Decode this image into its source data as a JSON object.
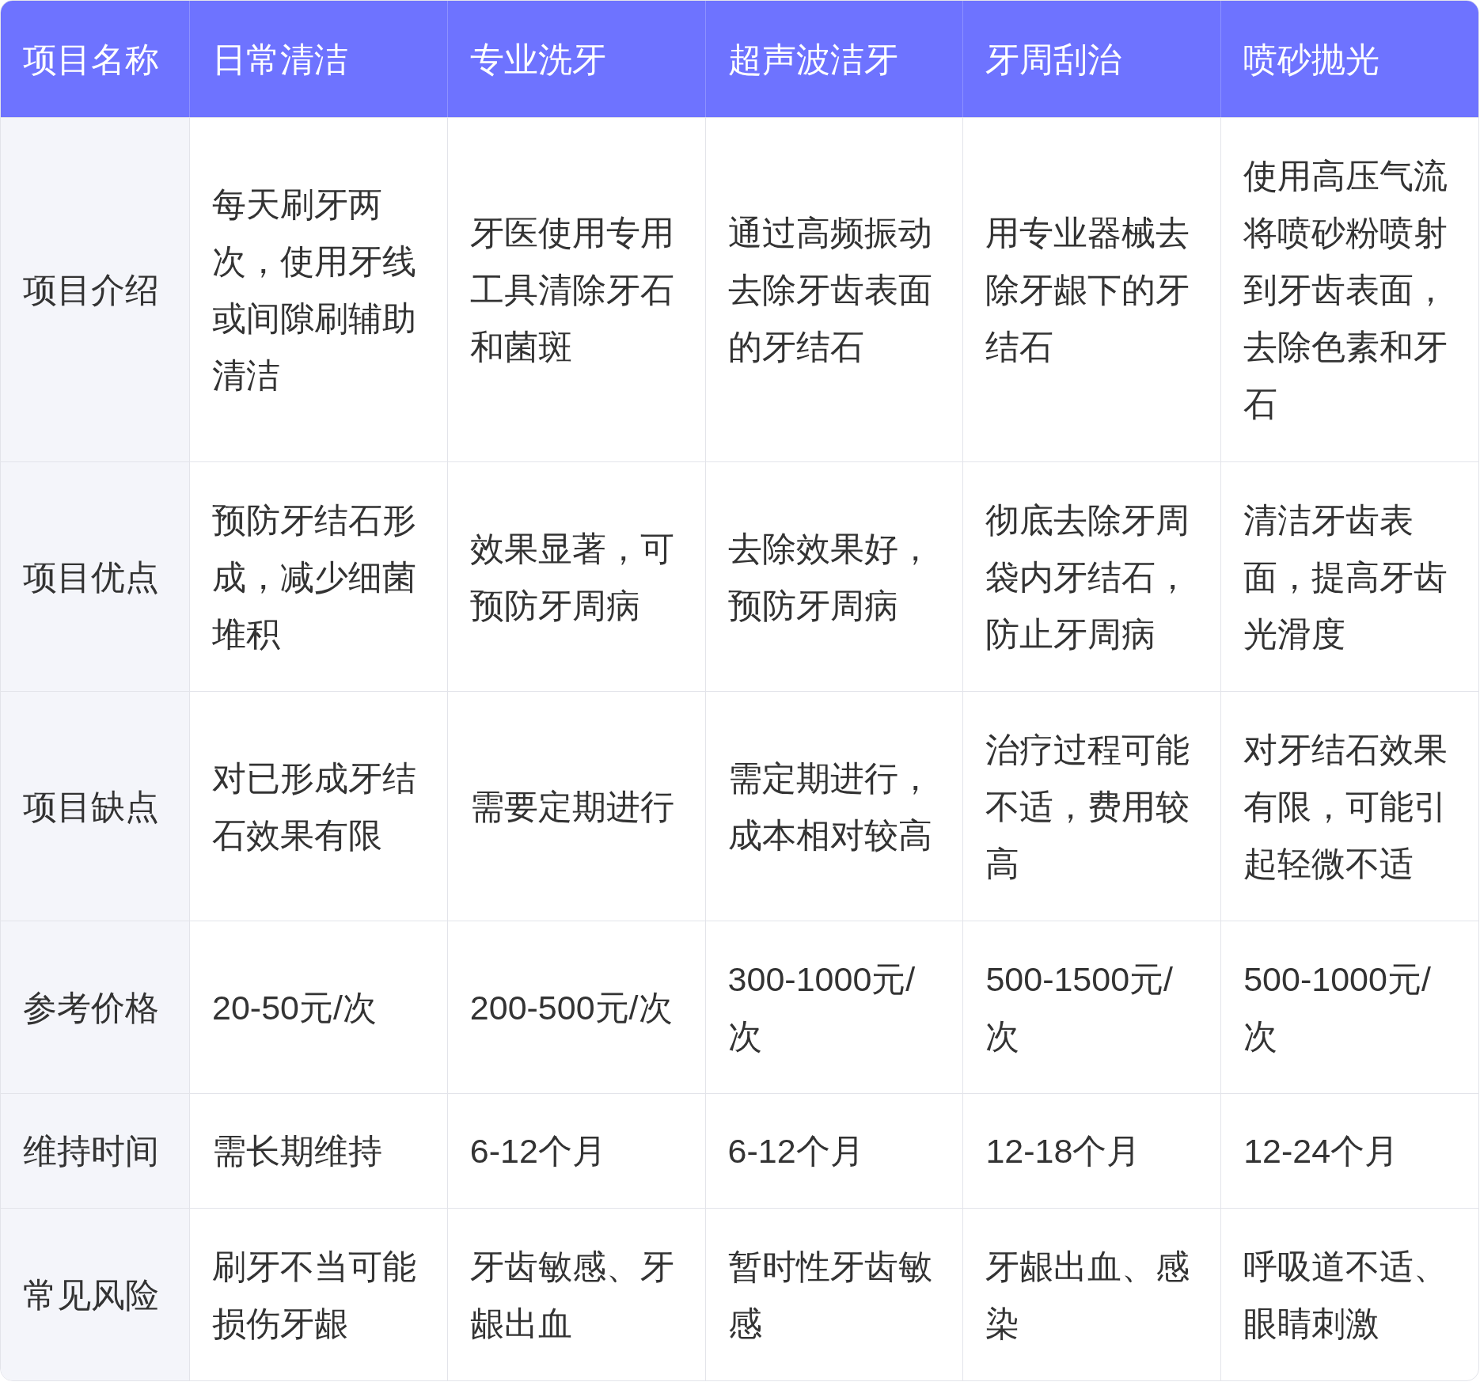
{
  "table": {
    "columns": [
      "项目名称",
      "日常清洁",
      "专业洗牙",
      "超声波洁牙",
      "牙周刮治",
      "喷砂抛光"
    ],
    "rows": [
      {
        "cells": [
          "项目介绍",
          "每天刷牙两次，使用牙线或间隙刷辅助清洁",
          "牙医使用专用工具清除牙石和菌斑",
          "通过高频振动去除牙齿表面的牙结石",
          "用专业器械去除牙龈下的牙结石",
          "使用高压气流将喷砂粉喷射到牙齿表面，去除色素和牙石"
        ]
      },
      {
        "cells": [
          "项目优点",
          "预防牙结石形成，减少细菌堆积",
          "效果显著，可预防牙周病",
          "去除效果好，预防牙周病",
          "彻底去除牙周袋内牙结石，防止牙周病",
          "清洁牙齿表面，提高牙齿光滑度"
        ]
      },
      {
        "cells": [
          "项目缺点",
          "对已形成牙结石效果有限",
          "需要定期进行",
          "需定期进行，成本相对较高",
          "治疗过程可能不适，费用较高",
          "对牙结石效果有限，可能引起轻微不适"
        ]
      },
      {
        "cells": [
          "参考价格",
          "20-50元/次",
          "200-500元/次",
          "300-1000元/次",
          "500-1500元/次",
          "500-1000元/次"
        ]
      },
      {
        "cells": [
          "维持时间",
          "需长期维持",
          "6-12个月",
          "6-12个月",
          "12-18个月",
          "12-24个月"
        ]
      },
      {
        "cells": [
          "常见风险",
          "刷牙不当可能损伤牙龈",
          "牙齿敏感、牙龈出血",
          "暂时性牙齿敏感",
          "牙龈出血、感染",
          "呼吸道不适、眼睛刺激"
        ]
      }
    ]
  }
}
